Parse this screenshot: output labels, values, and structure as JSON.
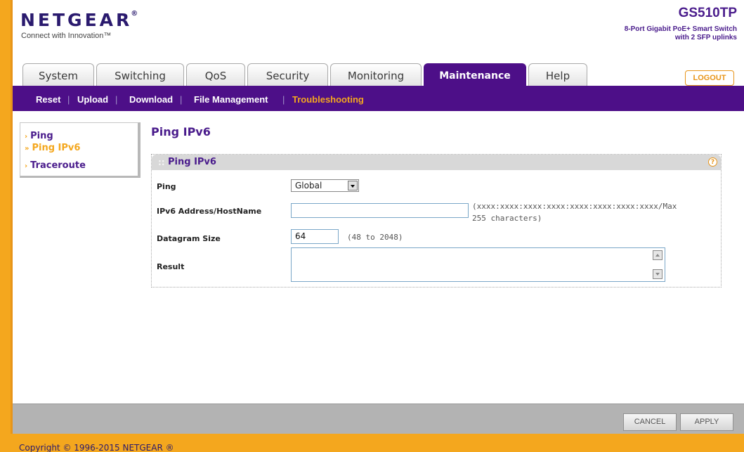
{
  "header": {
    "logo": "NETGEAR",
    "logo_mark": "®",
    "tagline": "Connect with Innovation™",
    "model": "GS510TP",
    "model_desc_line1": "8-Port Gigabit PoE+ Smart Switch",
    "model_desc_line2": "with 2 SFP uplinks",
    "logout": "LOGOUT"
  },
  "tabs": [
    {
      "label": "System"
    },
    {
      "label": "Switching"
    },
    {
      "label": "QoS"
    },
    {
      "label": "Security"
    },
    {
      "label": "Monitoring"
    },
    {
      "label": "Maintenance"
    },
    {
      "label": "Help"
    }
  ],
  "subnav": {
    "items": [
      "Reset",
      "Upload",
      "Download",
      "File Management",
      "Troubleshooting"
    ],
    "separator": "|"
  },
  "sidebar": {
    "items": [
      {
        "label": "Ping",
        "arrow": "›"
      },
      {
        "label": "Ping IPv6",
        "arrow": "»"
      },
      {
        "label": "Traceroute",
        "arrow": "›"
      }
    ]
  },
  "main": {
    "page_title": "Ping IPv6",
    "box_title": "Ping IPv6",
    "box_dots": "::",
    "help_glyph": "?",
    "fields": {
      "ping_label": "Ping",
      "ping_value": "Global",
      "address_label": "IPv6 Address/HostName",
      "address_value": "",
      "address_hint_line1": "(xxxx:xxxx:xxxx:xxxx:xxxx:xxxx:xxxx:xxxx/Max",
      "address_hint_line2": "255 characters)",
      "datagram_label": "Datagram Size",
      "datagram_value": "64",
      "datagram_hint": "(48 to 2048)",
      "result_label": "Result",
      "result_value": ""
    }
  },
  "footer": {
    "cancel": "CANCEL",
    "apply": "APPLY",
    "copyright": "Copyright © 1996-2015 NETGEAR ®"
  },
  "colors": {
    "brand_purple": "#4d0f88",
    "accent_orange": "#f4a71e"
  }
}
